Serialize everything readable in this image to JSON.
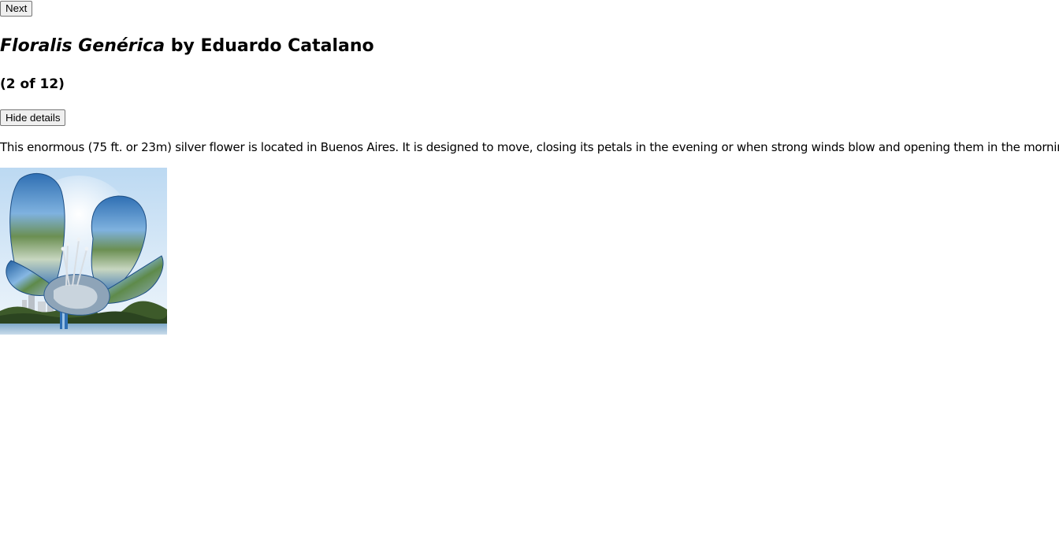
{
  "nav": {
    "next_label": "Next"
  },
  "artwork": {
    "title_italic": "Floralis Genérica",
    "title_rest": " by Eduardo Catalano",
    "counter": "(2 of 12)",
    "toggle_label": "Hide details",
    "description": "This enormous (75 ft. or 23m) silver flower is located in Buenos Aires. It is designed to move, closing its petals in the evening or when strong winds blow and opening them in the morning.",
    "image_alt": "Floralis Genérica sculpture"
  }
}
